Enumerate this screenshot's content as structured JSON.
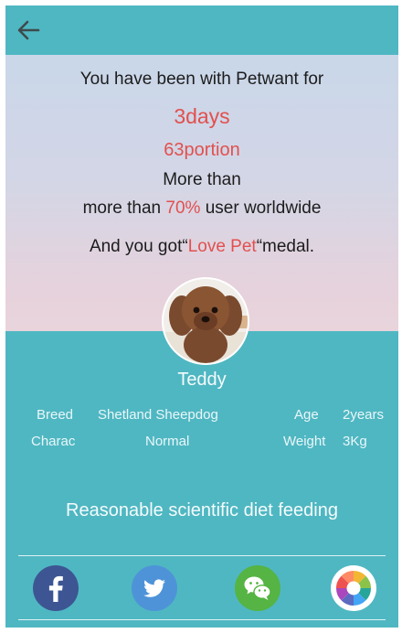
{
  "header": {
    "back_icon": "arrow-left-icon"
  },
  "summary": {
    "line1": "You have been with Petwant for",
    "days": "3days",
    "portion": "63portion",
    "more_than": "More than",
    "compare_prefix": "more than ",
    "compare_pct": "70%",
    "compare_suffix": " user worldwide",
    "medal_prefix": "And you got“",
    "medal_name": "Love Pet",
    "medal_suffix": "“medal."
  },
  "pet": {
    "name": "Teddy",
    "breed_label": "Breed",
    "breed_value": "Shetland Sheepdog",
    "age_label": "Age",
    "age_value": "2years",
    "charac_label": "Charac",
    "charac_value": "Normal",
    "weight_label": "Weight",
    "weight_value": "3Kg"
  },
  "diet_text": "Reasonable scientific diet feeding",
  "share": [
    {
      "name": "facebook-icon",
      "color": "#3d5593"
    },
    {
      "name": "twitter-icon",
      "color": "#4e93d8"
    },
    {
      "name": "wechat-icon",
      "color": "#55b443"
    },
    {
      "name": "photos-icon",
      "color": "#ffffff"
    }
  ],
  "colors": {
    "teal": "#4fb7c2",
    "accent_red": "#e2504e"
  }
}
